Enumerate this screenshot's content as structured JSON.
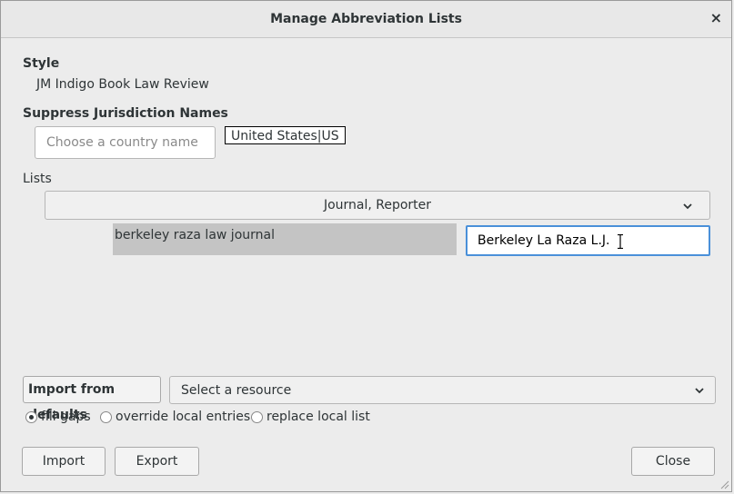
{
  "window": {
    "title": "Manage Abbreviation Lists",
    "close_glyph": "×"
  },
  "style_section": {
    "label": "Style",
    "value": "JM Indigo Book Law Review"
  },
  "suppress_section": {
    "label": "Suppress Jurisdiction Names",
    "country_placeholder": "Choose a country name",
    "selected_tag": "United States|US"
  },
  "lists_section": {
    "label": "Lists",
    "list_dropdown": {
      "selected": "Journal, Reporter"
    },
    "entries": [
      {
        "key": "berkeley raza law journal",
        "value": "Berkeley La Raza L.J."
      }
    ]
  },
  "import_section": {
    "label": "Import from defaults",
    "resource_dropdown": {
      "selected": "Select a resource"
    },
    "modes": [
      {
        "label": "fill gaps",
        "checked": true
      },
      {
        "label": "override local entries",
        "checked": false
      },
      {
        "label": "replace local list",
        "checked": false
      }
    ]
  },
  "footer": {
    "import_label": "Import",
    "export_label": "Export",
    "close_label": "Close"
  },
  "icons": {
    "close": "close-icon",
    "chevron": "chevron-down-icon",
    "cursor": "text-cursor-icon",
    "grip": "resize-grip-icon"
  }
}
